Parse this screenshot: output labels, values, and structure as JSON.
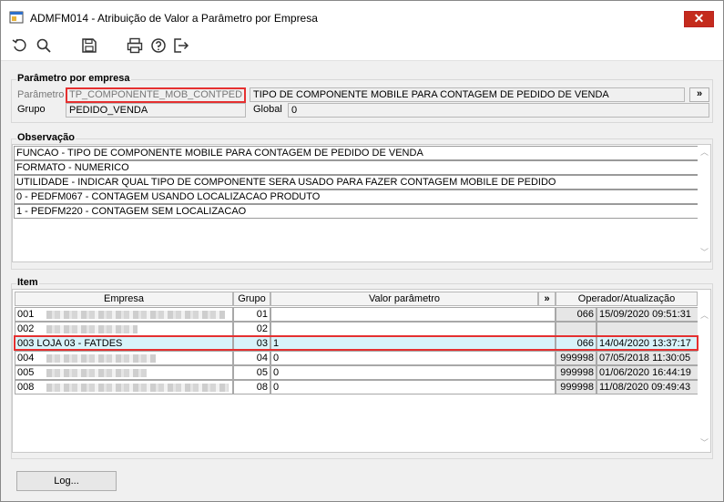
{
  "window": {
    "title": "ADMFM014 - Atribuição de Valor a Parâmetro por Empresa",
    "close_label": "✕"
  },
  "toolbar": {
    "icons": [
      "undo-icon",
      "search-icon",
      "save-icon",
      "print-icon",
      "help-icon",
      "exit-icon"
    ]
  },
  "param_section": {
    "legend": "Parâmetro por empresa",
    "parametro_label": "Parâmetro",
    "parametro_value": "TP_COMPONENTE_MOB_CONTPED",
    "parametro_desc": "TIPO DE COMPONENTE MOBILE PARA CONTAGEM DE PEDIDO DE VENDA",
    "more_label": "»",
    "grupo_label": "Grupo",
    "grupo_value": "PEDIDO_VENDA",
    "global_label": "Global",
    "global_value": "0"
  },
  "observacao": {
    "legend": "Observação",
    "lines": [
      "FUNCAO - TIPO DE COMPONENTE MOBILE PARA CONTAGEM DE PEDIDO DE VENDA",
      "FORMATO - NUMERICO",
      "UTILIDADE - INDICAR QUAL TIPO DE COMPONENTE SERA USADO PARA FAZER CONTAGEM MOBILE DE PEDIDO",
      "0 - PEDFM067 - CONTAGEM USANDO LOCALIZACAO PRODUTO",
      "1 - PEDFM220 - CONTAGEM SEM LOCALIZACAO"
    ]
  },
  "item": {
    "legend": "Item",
    "headers": {
      "empresa": "Empresa",
      "grupo": "Grupo",
      "valor": "Valor parâmetro",
      "more": "»",
      "operador": "Operador/Atualização"
    },
    "rows": [
      {
        "code": "001",
        "name": "",
        "grupo": "01",
        "valor": "",
        "operador": "066",
        "data": "15/09/2020 09:51:31"
      },
      {
        "code": "002",
        "name": "",
        "grupo": "02",
        "valor": "",
        "operador": "",
        "data": ""
      },
      {
        "code": "003",
        "name": "LOJA 03 - FATDES",
        "grupo": "03",
        "valor": "1",
        "operador": "066",
        "data": "14/04/2020 13:37:17"
      },
      {
        "code": "004",
        "name": "",
        "grupo": "04",
        "valor": "0",
        "operador": "999998",
        "data": "07/05/2018 11:30:05"
      },
      {
        "code": "005",
        "name": "",
        "grupo": "05",
        "valor": "0",
        "operador": "999998",
        "data": "01/06/2020 16:44:19"
      },
      {
        "code": "008",
        "name": "",
        "grupo": "08",
        "valor": "0",
        "operador": "999998",
        "data": "11/08/2020 09:49:43"
      }
    ]
  },
  "footer": {
    "log_label": "Log..."
  },
  "colors": {
    "highlight_border": "#e53030",
    "selected_row": "#d8f3fa",
    "close_button": "#c42b1c"
  }
}
